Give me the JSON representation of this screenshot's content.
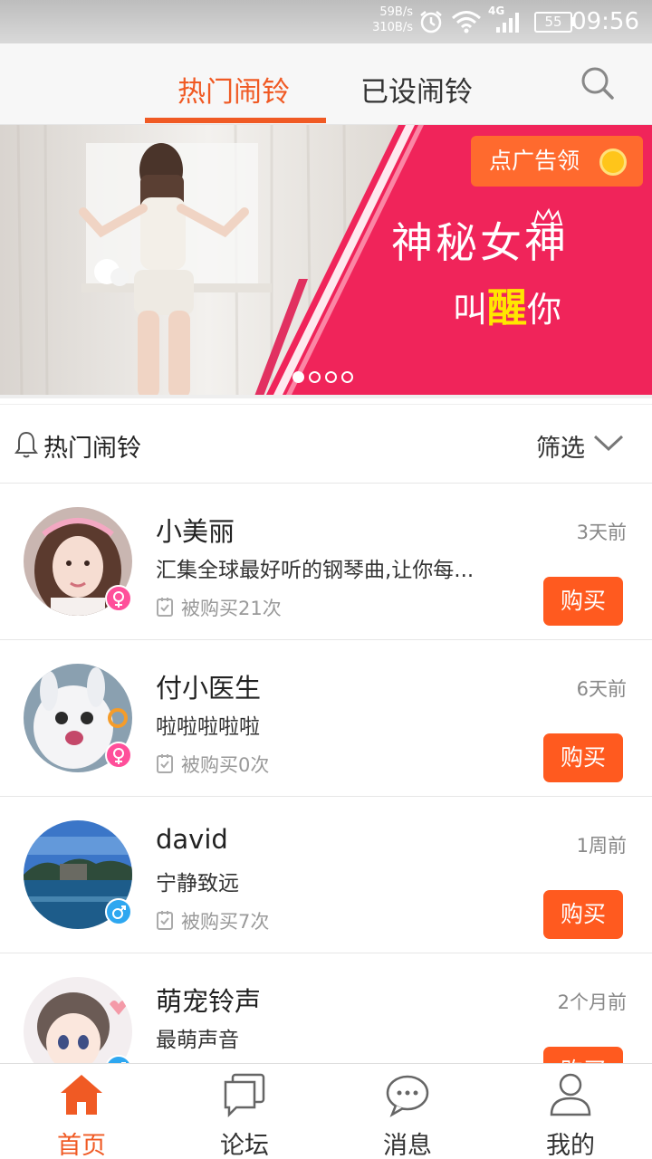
{
  "status_bar": {
    "net_down": "59B/s",
    "net_up": "310B/s",
    "network_type": "4G",
    "battery": "55",
    "time": "09:56"
  },
  "top_tabs": {
    "hot_label": "热门闹铃",
    "set_label": "已设闹铃",
    "active": "hot"
  },
  "banner": {
    "ad_button_label": "点广告领",
    "title": "神秘女神",
    "subtitle_left": "叫",
    "subtitle_mid": "醒",
    "subtitle_right": "你",
    "slide_count": 4,
    "active_slide": 1
  },
  "section": {
    "title": "热门闹铃",
    "filter_label": "筛选"
  },
  "items": [
    {
      "name": "小美丽",
      "desc": "汇集全球最好听的钢琴曲,让你每...",
      "bought": "被购买21次",
      "time": "3天前",
      "gender": "female",
      "buy_label": "购买"
    },
    {
      "name": "付小医生",
      "desc": "啦啦啦啦啦",
      "bought": "被购买0次",
      "time": "6天前",
      "gender": "female",
      "buy_label": "购买"
    },
    {
      "name": "david",
      "desc": "宁静致远",
      "bought": "被购买7次",
      "time": "1周前",
      "gender": "male",
      "buy_label": "购买"
    },
    {
      "name": "萌宠铃声",
      "desc": "最萌声音",
      "bought": "",
      "time": "2个月前",
      "gender": "male",
      "buy_label": "购买"
    }
  ],
  "bottom_nav": [
    {
      "label": "首页",
      "icon": "home-icon",
      "active": true
    },
    {
      "label": "论坛",
      "icon": "forum-icon",
      "active": false
    },
    {
      "label": "消息",
      "icon": "message-icon",
      "active": false
    },
    {
      "label": "我的",
      "icon": "profile-icon",
      "active": false
    }
  ],
  "colors": {
    "accent": "#f05a24",
    "buy_button": "#ff5a1f",
    "banner_pink": "#f0245a",
    "female": "#ff4f9a",
    "male": "#2ea7f0"
  }
}
